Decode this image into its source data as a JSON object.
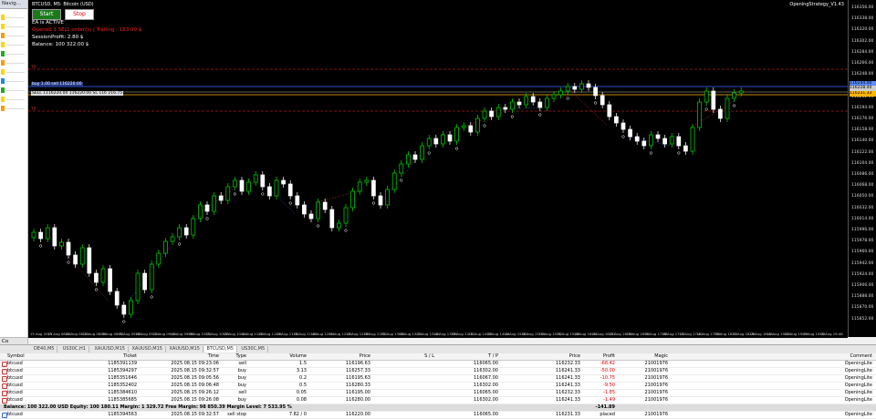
{
  "navigator": {
    "title": "Navig...",
    "bottom_label": "Co"
  },
  "chart": {
    "title": "BTCUSD, M5: Bitcoin (USD)",
    "ea_name": "OpeningStrategy_V1.43",
    "buttons": {
      "start_label": "Start",
      "stop_label": "Stop"
    },
    "info": {
      "status": "EA is ACTIVE",
      "error": "Opened 1 SELL order(s) | Trailing - 163.00 $",
      "session_profit": "SessionProfit: 2.80 $",
      "balance": "Balance: 100 322.00 $"
    },
    "line_labels": {
      "top": "TP",
      "buy_entry": "buy 1.00 sell 116220.00",
      "sell_entry": "SELL 1116220.00 116220.00 SL 116 216.75",
      "bottom": "TP"
    },
    "price_labels": [
      "116356.00",
      "116338.00",
      "116320.00",
      "116302.00",
      "116284.00",
      "116266.00",
      "116248.00",
      "116230.00",
      "116212.00",
      "116194.00",
      "116176.00",
      "116158.00",
      "116140.00",
      "116122.00",
      "116104.00",
      "116086.00",
      "116068.00",
      "116050.00",
      "116032.00",
      "116014.00",
      "115996.00",
      "115978.00",
      "115960.00",
      "115942.00",
      "115924.00",
      "115906.00",
      "115888.00",
      "115870.00",
      "115852.00"
    ],
    "price_tags": {
      "blue": "116244.00",
      "orange": "116231.33",
      "gray": "116228.40"
    },
    "time_labels": [
      "15 Aug 2025",
      "15 Aug 08:04",
      "15 Aug 08:20",
      "15 Aug 08:36",
      "15 Aug 08:52",
      "15 Aug 09:08",
      "15 Aug 09:24",
      "15 Aug 09:40",
      "15 Aug 09:56",
      "15 Aug 10:12",
      "15 Aug 10:28",
      "15 Aug 10:44",
      "15 Aug 11:00",
      "15 Aug 11:16",
      "15 Aug 11:32",
      "15 Aug 11:48",
      "15 Aug 12:04",
      "15 Aug 12:20",
      "15 Aug 12:36",
      "15 Aug 12:52",
      "15 Aug 13:08",
      "15 Aug 13:24",
      "15 Aug 13:40",
      "15 Aug 13:56",
      "15 Aug 14:12",
      "15 Aug 14:28",
      "15 Aug 14:44",
      "15 Aug 15:00",
      "15 Aug 15:16",
      "15 Aug 15:32",
      "15 Aug 15:48",
      "15 Aug 16:04",
      "15 Aug 16:20",
      "15 Aug 16:36",
      "15 Aug 16:52",
      "15 Aug 17:08",
      "15 Aug 17:24",
      "15 Aug 17:40",
      "15 Aug 17:56",
      "15 Aug 18:12",
      "15 Aug 18:28",
      "15 Aug 18:44",
      "15 Aug 19:00",
      "15 Aug 19:16",
      "15 Aug 19:32",
      "15 Aug 19:48"
    ]
  },
  "symbol_tabs": [
    "DE40,M5",
    "US30C,H1",
    "XAUUSD,M15",
    "XAUUSD,M15",
    "XAUUSD,M15",
    "BTCUSD,M5",
    "US30C,M5"
  ],
  "active_tab_index": 5,
  "table": {
    "headers": [
      "Symbol",
      "Ticket",
      "Time",
      "Type",
      "Volume",
      "Price",
      "S / L",
      "T / P",
      "Price",
      "Profit",
      "Magic",
      "Comment"
    ],
    "rows": [
      {
        "symbol": "btcusd",
        "ticket": "1185391139",
        "time": "2025.08.15 09:23:06",
        "type": "sell",
        "volume": "1.5",
        "price": "116196.63",
        "sl": "",
        "tp": "116065.00",
        "cprice": "116232.33",
        "profit": "-68.42",
        "magic": "21001976",
        "comment": "OpeningLite"
      },
      {
        "symbol": "btcusd",
        "ticket": "1185394297",
        "time": "2025.08.15 09:32:57",
        "type": "buy",
        "volume": "3.13",
        "price": "116257.33",
        "sl": "",
        "tp": "116302.00",
        "cprice": "116241.33",
        "profit": "-50.00",
        "magic": "21001976",
        "comment": "OpeningLite"
      },
      {
        "symbol": "btcusd",
        "ticket": "1185351646",
        "time": "2025.08.15 09:05:56",
        "type": "buy",
        "volume": "0.2",
        "price": "116195.63",
        "sl": "",
        "tp": "116067.00",
        "cprice": "116241.33",
        "profit": "-10.75",
        "magic": "21001976",
        "comment": "OpeningLite"
      },
      {
        "symbol": "btcusd",
        "ticket": "1185352402",
        "time": "2025.08.15 09:06:48",
        "type": "buy",
        "volume": "0.5",
        "price": "116280.33",
        "sl": "",
        "tp": "116302.00",
        "cprice": "116241.33",
        "profit": "-9.50",
        "magic": "21001976",
        "comment": "OpeningLite"
      },
      {
        "symbol": "btcusd",
        "ticket": "1185384610",
        "time": "2025.08.15 09:26:12",
        "type": "sell",
        "volume": "0.05",
        "price": "116195.00",
        "sl": "",
        "tp": "116065.00",
        "cprice": "116232.33",
        "profit": "-1.85",
        "magic": "21001976",
        "comment": "OpeningLite"
      },
      {
        "symbol": "btcusd",
        "ticket": "1185385685",
        "time": "2025.08.15 09:26:08",
        "type": "buy",
        "volume": "0.08",
        "price": "116280.00",
        "sl": "",
        "tp": "116302.00",
        "cprice": "116241.33",
        "profit": "-1.49",
        "magic": "21001976",
        "comment": "OpeningLite"
      }
    ],
    "balance_line": "Balance: 100 322.00 USD  Equity: 100 180.11  Margin: 1 329.72  Free Margin: 98 850.39  Margin Level: 7 533.95 %",
    "balance_profit": "-141.89",
    "pending": {
      "symbol": "btcusd",
      "ticket": "1185394563",
      "time": "2025.08.15 09:32:57",
      "type": "sell stop",
      "volume": "7.82 / 0",
      "price": "116220.00",
      "sl": "",
      "tp": "116065.00",
      "cprice": "116231.33",
      "profit": "placed",
      "magic": "21001976",
      "comment": "OpeningLite"
    }
  },
  "colors": {
    "bull": "#00dd00",
    "bear": "#ffffff",
    "blue_line": "#3b6cff",
    "orange_line": "#ffb400",
    "red_line": "#aa1a1a"
  }
}
